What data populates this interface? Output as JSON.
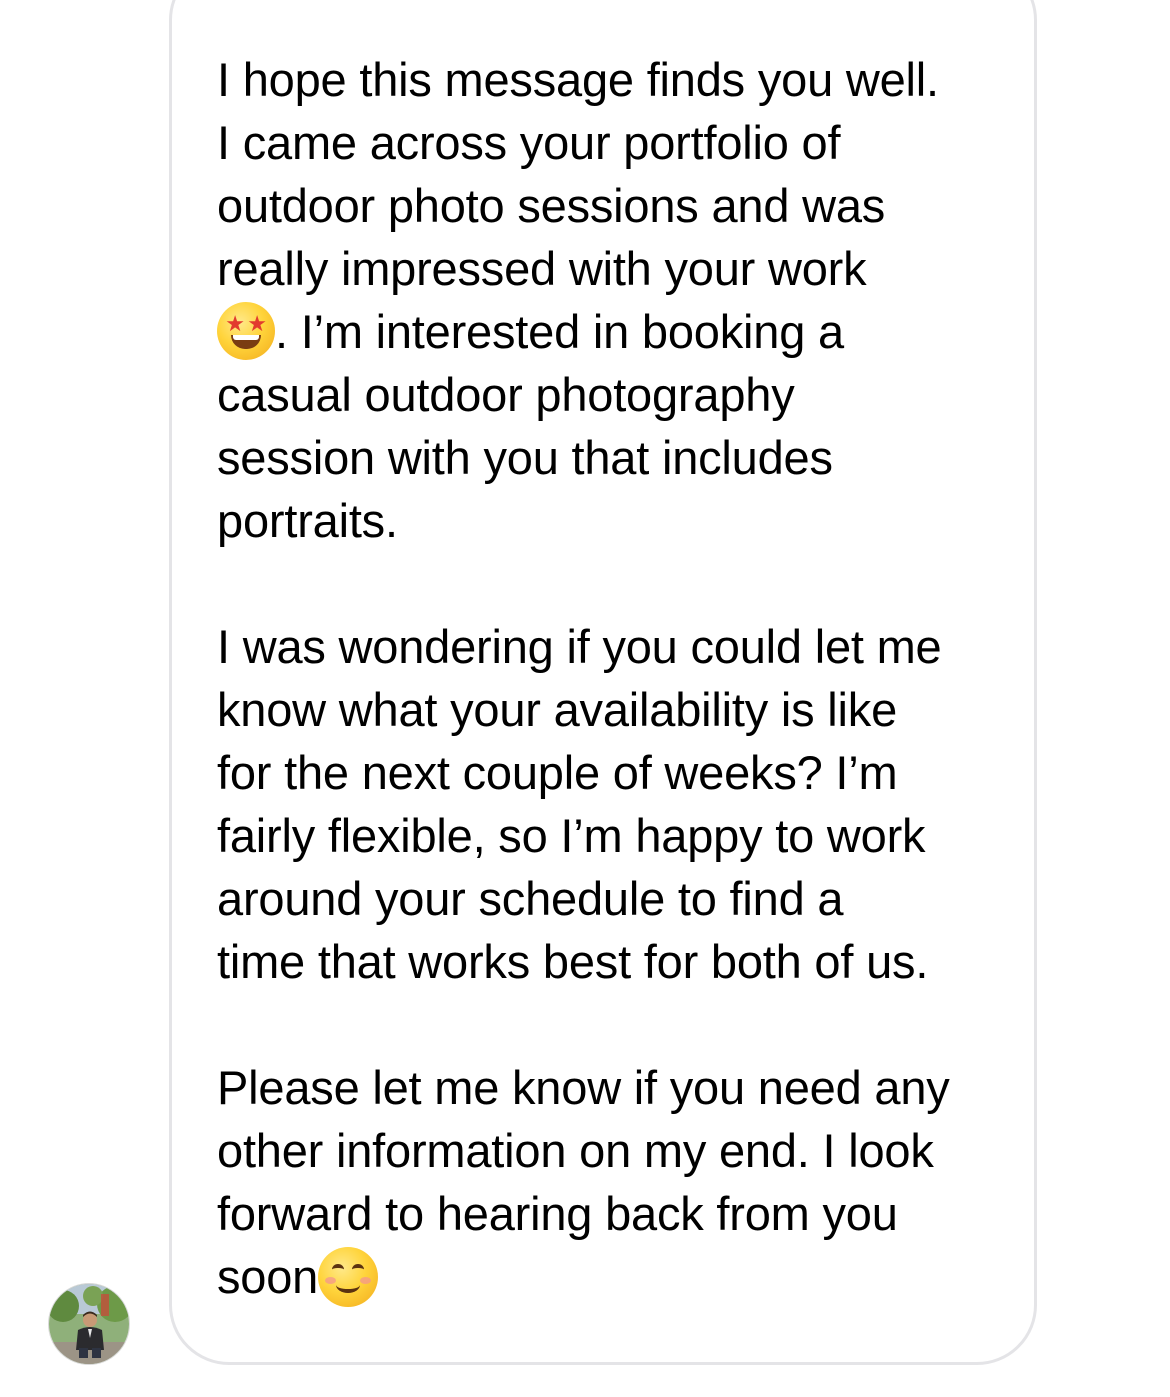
{
  "message": {
    "paragraphs": [
      {
        "lines": [
          "I hope this message finds you well.",
          "I came across your portfolio of",
          "outdoor photo sessions and was",
          "really impressed with your work"
        ],
        "emoji_line_text": ". I’m  interested in booking a",
        "emoji": "star-struck-emoji-icon",
        "lines_after": [
          "casual outdoor photography",
          "session with you that includes",
          "portraits."
        ]
      },
      {
        "lines": [
          "I was wondering if you could let me",
          "know what your availability is like",
          "for the next couple of weeks? I’m",
          "fairly flexible, so I’m happy to work",
          "around your schedule to find a",
          "time that works best for both of us."
        ]
      },
      {
        "lines": [
          "Please let me know if you need any",
          "other information on my end. I look",
          "forward to hearing back from you"
        ],
        "last_line_text": "soon",
        "last_line_emoji": "smiling-face-emoji-icon"
      }
    ]
  },
  "sender": {
    "avatar": "profile-photo"
  },
  "colors": {
    "bubble_border": "#e4e4e7",
    "text": "#000000",
    "background": "#ffffff"
  }
}
